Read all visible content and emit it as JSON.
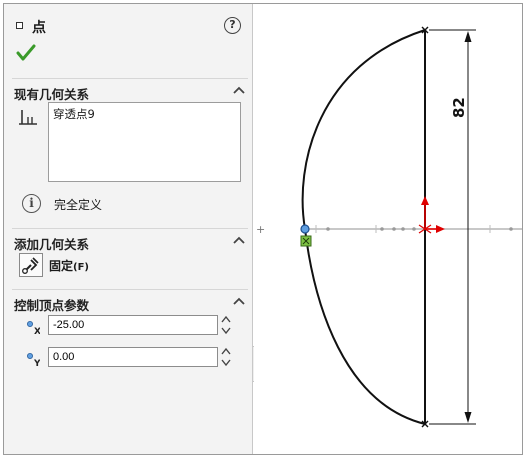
{
  "property_manager": {
    "title": "点",
    "help_glyph": "?",
    "existing_relations": {
      "header": "现有几何关系",
      "items": [
        "穿透点9"
      ]
    },
    "status": "完全定义",
    "add_relations": {
      "header": "添加几何关系",
      "fix_label": "固定",
      "fix_shortcut": "(F)"
    },
    "vertex_params": {
      "header": "控制顶点参数",
      "x_value": "-25.00",
      "y_value": "0.00",
      "x_axis": "X",
      "y_axis": "Y"
    }
  },
  "sketch": {
    "dimension_value": "82",
    "origin_glyph": "+"
  },
  "colors": {
    "confirm_green": "#3a9a2a",
    "origin_red": "#e00000",
    "selected_point_blue": "#5f9ee0",
    "fix_marker_green": "#7ec244"
  },
  "icons": {
    "confirm": "check-icon",
    "help": "help-icon",
    "collapse": "chevron-up-icon",
    "relation": "pierce-relation-icon",
    "info": "info-icon",
    "fix": "fix-relation-icon",
    "point": "point-icon"
  }
}
